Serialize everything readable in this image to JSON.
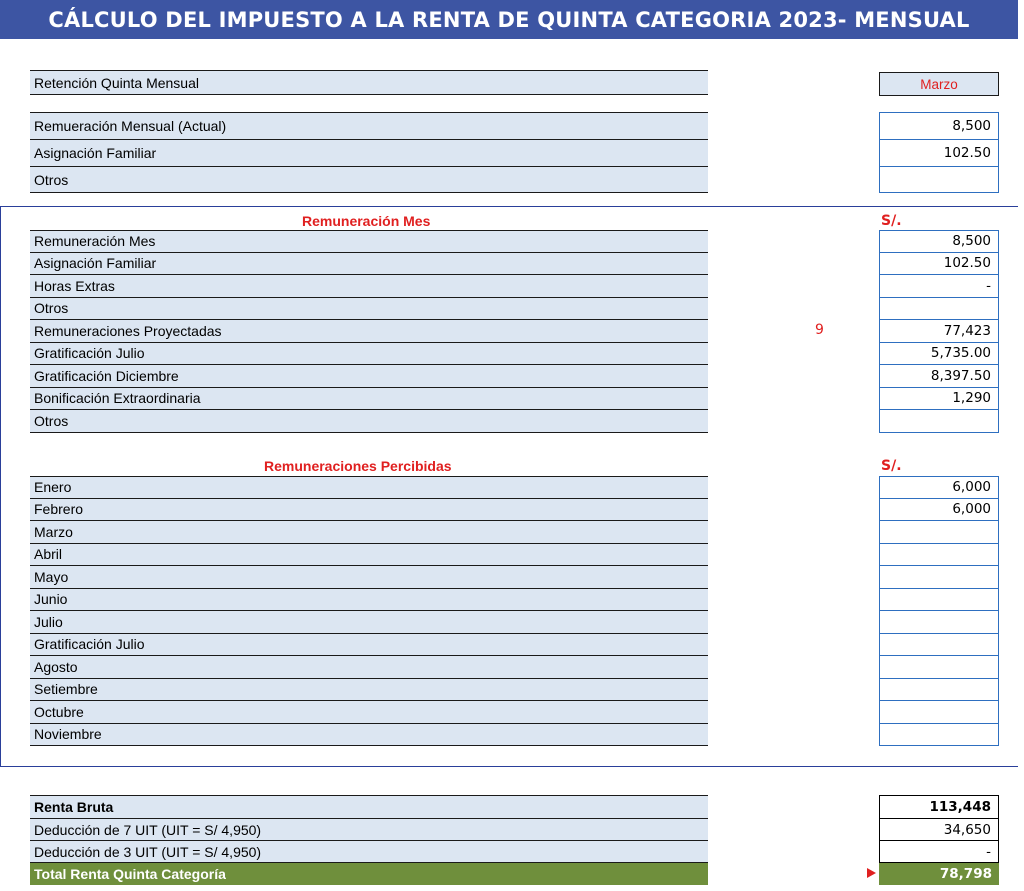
{
  "title": "CÁLCULO DEL IMPUESTO A LA RENTA DE QUINTA CATEGORIA 2023- MENSUAL",
  "header": {
    "retencion_label": "Retención Quinta Mensual",
    "month_value": "Marzo",
    "rows": [
      {
        "label": "Remueración Mensual (Actual)",
        "value": "8,500"
      },
      {
        "label": "Asignación Familiar",
        "value": "102.50"
      },
      {
        "label": "Otros",
        "value": ""
      }
    ]
  },
  "remuneracion_mes": {
    "title": "Remuneración Mes",
    "currency": "S/.",
    "projected_months": "9",
    "rows": [
      {
        "label": "Remuneración Mes",
        "value": "8,500"
      },
      {
        "label": "Asignación Familiar",
        "value": "102.50"
      },
      {
        "label": "Horas Extras",
        "value": "-"
      },
      {
        "label": "Otros",
        "value": ""
      },
      {
        "label": "Remuneraciones Proyectadas",
        "value": "77,423"
      },
      {
        "label": "Gratificación Julio",
        "value": "5,735.00"
      },
      {
        "label": "Gratificación Diciembre",
        "value": "8,397.50"
      },
      {
        "label": "Bonificación Extraordinaria",
        "value": "1,290"
      },
      {
        "label": "Otros",
        "value": ""
      }
    ]
  },
  "remuneraciones_percibidas": {
    "title": "Remuneraciones Percibidas",
    "currency": "S/.",
    "rows": [
      {
        "label": "Enero",
        "value": "6,000"
      },
      {
        "label": "Febrero",
        "value": "6,000"
      },
      {
        "label": "Marzo",
        "value": ""
      },
      {
        "label": "Abril",
        "value": ""
      },
      {
        "label": "Mayo",
        "value": ""
      },
      {
        "label": "Junio",
        "value": ""
      },
      {
        "label": "Julio",
        "value": ""
      },
      {
        "label": "Gratificación Julio",
        "value": ""
      },
      {
        "label": "Agosto",
        "value": ""
      },
      {
        "label": "Setiembre",
        "value": ""
      },
      {
        "label": "Octubre",
        "value": ""
      },
      {
        "label": "Noviembre",
        "value": ""
      }
    ]
  },
  "totals": {
    "renta_bruta": {
      "label": "Renta Bruta",
      "value": "113,448"
    },
    "deduccion_7": {
      "label": "Deducción de 7 UIT  (UIT = S/ 4,950)",
      "value": "34,650"
    },
    "deduccion_3": {
      "label": "Deducción de 3 UIT (UIT = S/ 4,950)",
      "value": "-"
    },
    "total": {
      "label": "Total Renta Quinta Categoría",
      "value": "78,798"
    }
  },
  "colors": {
    "title_bg": "#3d55a3",
    "label_bg": "#dce6f2",
    "accent_red": "#e02020",
    "total_green": "#6f8f3c",
    "input_border": "#2e6fc0"
  }
}
